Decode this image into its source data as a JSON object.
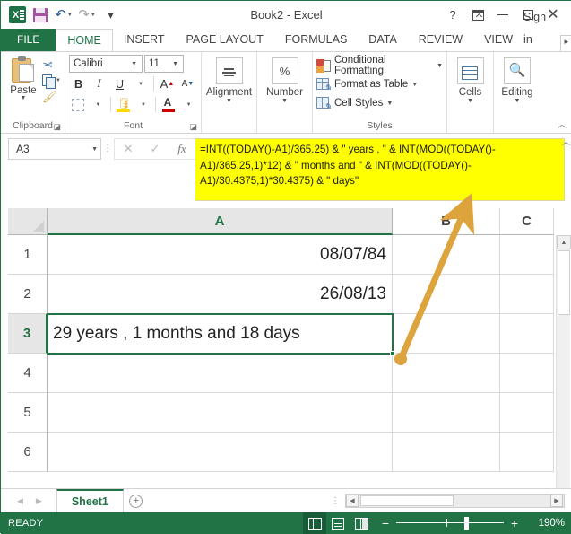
{
  "window": {
    "title": "Book2 - Excel",
    "quick_access": [
      {
        "name": "excel-logo",
        "label": "Excel"
      },
      {
        "name": "save",
        "label": "Save"
      },
      {
        "name": "undo",
        "label": "Undo"
      },
      {
        "name": "redo",
        "label": "Redo"
      },
      {
        "name": "customize",
        "label": "Customize Quick Access Toolbar"
      }
    ],
    "controls": {
      "help": "?",
      "ribbon_display": "Ribbon Display Options",
      "minimize": "Minimize",
      "restore": "Restore Down",
      "close": "Close"
    }
  },
  "tabs": {
    "file": "FILE",
    "items": [
      "HOME",
      "INSERT",
      "PAGE LAYOUT",
      "FORMULAS",
      "DATA",
      "REVIEW",
      "VIEW"
    ],
    "active": "HOME",
    "signin": "Sign in"
  },
  "ribbon": {
    "clipboard": {
      "label": "Clipboard",
      "paste": "Paste",
      "cut": "Cut",
      "copy": "Copy",
      "format_painter": "Format Painter"
    },
    "font": {
      "label": "Font",
      "family": "Calibri",
      "size": "11",
      "bold": "B",
      "italic": "I",
      "underline": "U",
      "grow": "A",
      "shrink": "A",
      "borders": "Borders",
      "fill_color": "Fill Color",
      "font_color": "A"
    },
    "alignment": {
      "label": "Alignment"
    },
    "number": {
      "label": "Number",
      "symbol": "%"
    },
    "styles": {
      "label": "Styles",
      "items": [
        "Conditional Formatting",
        "Format as Table",
        "Cell Styles"
      ]
    },
    "cells": {
      "label": "Cells"
    },
    "editing": {
      "label": "Editing"
    }
  },
  "formula_bar": {
    "name_box": "A3",
    "cancel": "Cancel",
    "enter": "Enter",
    "insert_function": "fx",
    "formula": "=INT((TODAY()-A1)/365.25) & \" years , \" & INT(MOD((TODAY()-A1)/365.25,1)*12) & \" months and \" & INT(MOD((TODAY()-A1)/30.4375,1)*30.4375) & \" days\"",
    "expand": "Expand Formula Bar"
  },
  "grid": {
    "columns": [
      "A",
      "B",
      "C"
    ],
    "rows": [
      "1",
      "2",
      "3",
      "4",
      "5",
      "6"
    ],
    "selected_cell": "A3",
    "cells": {
      "A1": "08/07/84",
      "A2": "26/08/13",
      "A3": "29 years , 1 months and 18 days"
    }
  },
  "sheet_bar": {
    "sheets": [
      "Sheet1"
    ],
    "active": "Sheet1",
    "add_sheet": "+",
    "prev": "◀",
    "next": "▶"
  },
  "status_bar": {
    "mode": "READY",
    "views": [
      "Normal",
      "Page Layout",
      "Page Break Preview"
    ],
    "active_view": "Normal",
    "zoom_out": "−",
    "zoom_in": "+",
    "zoom_level": "190%"
  },
  "annotation": {
    "arrow_color": "#dda33c",
    "description": "arrow from cell A3 to formula bar"
  }
}
